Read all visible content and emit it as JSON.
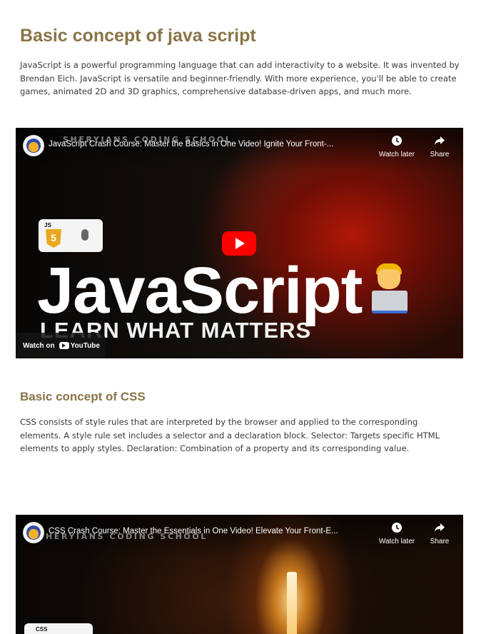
{
  "sections": [
    {
      "title": "Basic concept of java script",
      "description": "JavaScript is a powerful programming language that can add interactivity to a website. It was invented by Brendan Eich. JavaScript is versatile and beginner-friendly. With more experience, you'll be able to create games, animated 2D and 3D graphics, comprehensive database-driven apps, and much more.",
      "video": {
        "channel_watermark": "SHERYIANS CODING SCHOOL",
        "title": "JavaScript Crash Course: Master the Basics in One Video! Ignite Your Front-...",
        "watch_later_label": "Watch later",
        "share_label": "Share",
        "thumbnail_headline": "JavaScript",
        "thumbnail_subline": "LEARN WHAT MATTERS",
        "thumbnail_badge": "JS",
        "thumbnail_shield": "5",
        "watch_on_label": "Watch on",
        "youtube_label": "YouTube"
      }
    },
    {
      "title": "Basic concept of CSS",
      "description": "CSS consists of style rules that are interpreted by the browser and applied to the corresponding elements. A style rule set includes a selector and a declaration block. Selector: Targets specific HTML elements to apply styles. Declaration: Combination of a property and its corresponding value.",
      "video": {
        "channel_watermark": "HERYIANS CODING SCHOOL",
        "title": "CSS Crash Course: Master the Essentials in One Video! Elevate Your Front-E...",
        "watch_later_label": "Watch later",
        "share_label": "Share",
        "thumbnail_badge": "CSS"
      }
    }
  ],
  "icons": {
    "watch_later": "clock-icon",
    "share": "share-arrow-icon",
    "play": "play-icon",
    "channel": "channel-avatar-icon"
  },
  "colors": {
    "heading": "#8a7448",
    "body_text": "#3a3a3a",
    "play_button": "#ff0000"
  }
}
